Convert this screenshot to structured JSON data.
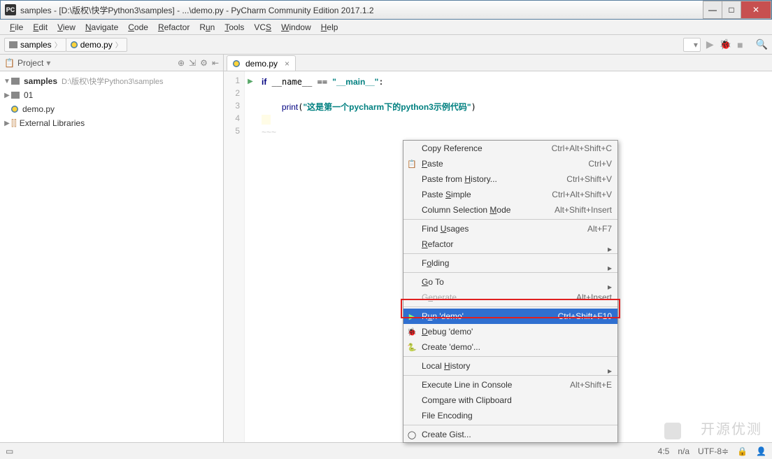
{
  "window": {
    "title": "samples - [D:\\版权\\快学Python3\\samples] - ...\\demo.py - PyCharm Community Edition 2017.1.2"
  },
  "menu": [
    "File",
    "Edit",
    "View",
    "Navigate",
    "Code",
    "Refactor",
    "Run",
    "Tools",
    "VCS",
    "Window",
    "Help"
  ],
  "breadcrumb": {
    "folder": "samples",
    "file": "demo.py"
  },
  "toolbar_right": {
    "config": "▾",
    "run": "▶",
    "debug": "🐞",
    "stop": "■",
    "search": "🔍"
  },
  "project": {
    "label": "Project",
    "root": {
      "name": "samples",
      "path": "D:\\版权\\快学Python3\\samples"
    },
    "child_folder": "01",
    "child_file": "demo.py",
    "ext_lib": "External Libraries"
  },
  "tab": {
    "name": "demo.py"
  },
  "code": {
    "l1": "if __name__ == \"__main__\":",
    "l3_fn": "print",
    "l3_arg": "\"这是第一个pycharm下的python3示例代码\""
  },
  "ctx": {
    "copyref": {
      "t": "Copy Reference",
      "s": "Ctrl+Alt+Shift+C"
    },
    "paste": {
      "t": "Paste",
      "s": "Ctrl+V"
    },
    "pastehist": {
      "t": "Paste from History...",
      "s": "Ctrl+Shift+V"
    },
    "pastesimple": {
      "t": "Paste Simple",
      "s": "Ctrl+Alt+Shift+V"
    },
    "colsel": {
      "t": "Column Selection Mode",
      "s": "Alt+Shift+Insert"
    },
    "findusages": {
      "t": "Find Usages",
      "s": "Alt+F7"
    },
    "refactor": {
      "t": "Refactor"
    },
    "folding": {
      "t": "Folding"
    },
    "goto": {
      "t": "Go To"
    },
    "generate": {
      "t": "Generate...",
      "s": "Alt+Insert"
    },
    "run": {
      "t": "Run 'demo'",
      "s": "Ctrl+Shift+F10"
    },
    "debug": {
      "t": "Debug 'demo'"
    },
    "create": {
      "t": "Create 'demo'..."
    },
    "localhist": {
      "t": "Local History"
    },
    "execline": {
      "t": "Execute Line in Console",
      "s": "Alt+Shift+E"
    },
    "compare": {
      "t": "Compare with Clipboard"
    },
    "fileenc": {
      "t": "File Encoding"
    },
    "gist": {
      "t": "Create Gist..."
    }
  },
  "status": {
    "pos": "4:5",
    "na": "n/a",
    "enc": "UTF-8",
    "lock": "🔒"
  },
  "watermark": "开源优测"
}
